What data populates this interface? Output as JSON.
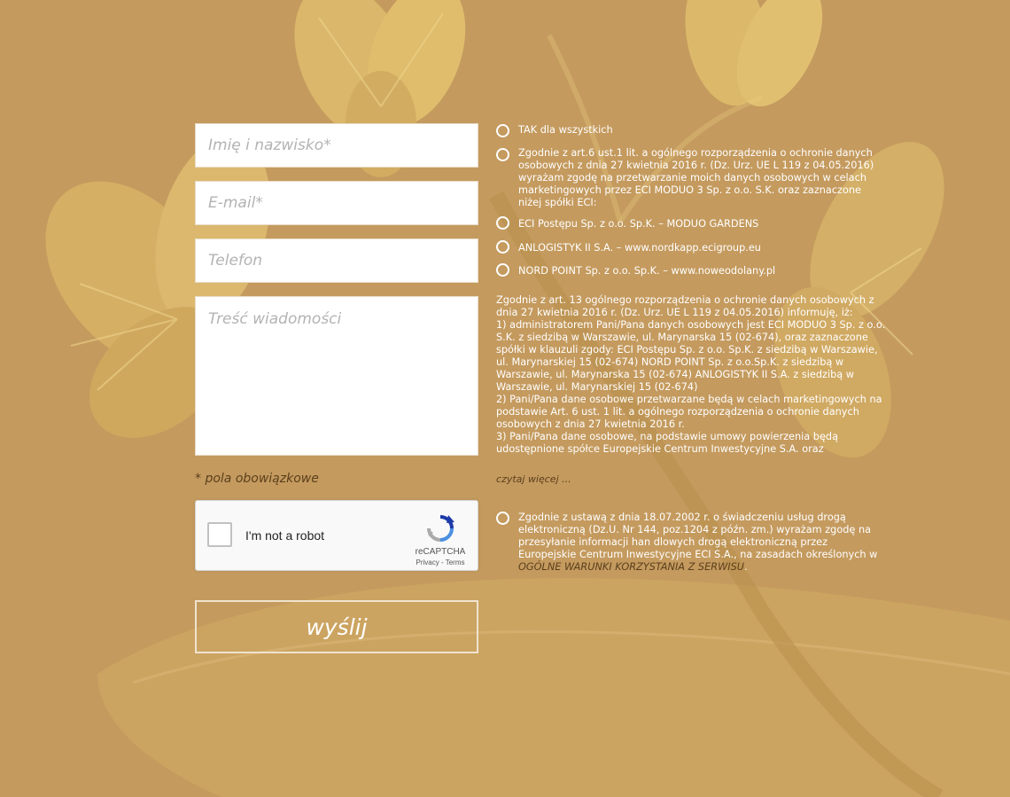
{
  "form": {
    "name_placeholder": "Imię i nazwisko*",
    "email_placeholder": "E-mail*",
    "phone_placeholder": "Telefon",
    "message_placeholder": "Treść wiadomości",
    "required_note": "* pola obowiązkowe",
    "submit_label": "wyślij"
  },
  "captcha": {
    "label": "I'm not a robot",
    "brand": "reCAPTCHA",
    "links": "Privacy - Terms"
  },
  "consents": {
    "all": "TAK dla wszystkich",
    "main": "Zgodnie z art.6 ust.1 lit. a ogólnego rozporządzenia o ochronie danych osobowych z dnia 27 kwietnia 2016 r. (Dz. Urz. UE L 119 z 04.05.2016) wyrażam zgodę na przetwarzanie moich danych osobowych w celach marketingowych przez ECI MODUO 3 Sp. z o.o. S.K. oraz zaznaczone niżej spółki ECI:",
    "company1": "ECI Postępu Sp. z o.o. Sp.K. – MODUO GARDENS",
    "company2": "ANLOGISTYK II S.A. – www.nordkapp.ecigroup.eu",
    "company3": "NORD POINT Sp. z o.o. Sp.K. – www.noweodolany.pl",
    "info": "Zgodnie z art. 13 ogólnego rozporządzenia o ochronie danych osobowych z dnia 27 kwietnia 2016 r. (Dz. Urz. UE L 119 z 04.05.2016) informuję, iż:\n1) administratorem Pani/Pana danych osobowych jest ECI MODUO 3 Sp. z o.o. S.K. z siedzibą w Warszawie, ul. Marynarska 15 (02-674), oraz zaznaczone spółki w klauzuli zgody: ECI Postępu Sp. z o.o. Sp.K. z siedzibą w Warszawie, ul. Marynarskiej 15 (02-674) NORD POINT Sp. z o.o.Sp.K. z siedzibą w Warszawie, ul. Marynarska 15 (02-674) ANLOGISTYK II S.A. z siedzibą w Warszawie, ul. Marynarskiej 15 (02-674)\n2) Pani/Pana dane osobowe przetwarzane będą w celach marketingowych na podstawie Art. 6 ust. 1 lit. a ogólnego rozporządzenia o ochronie danych osobowych z dnia 27 kwietnia 2016 r.\n3) Pani/Pana dane osobowe, na podstawie umowy powierzenia będą udostępnione spółce Europejskie Centrum Inwestycyjne S.A. oraz",
    "read_more": "czytaj więcej ...",
    "electronic": "Zgodnie z ustawą z dnia 18.07.2002 r. o świadczeniu usług drogą elektroniczną (Dz.U. Nr 144, poz.1204 z późn. zm.) wyrażam zgodę na przesyłanie informacji han  dlowych drogą elektroniczną przez Europejskie Centrum Inwestycyjne ECI S.A., na zasadach określonych w ",
    "terms_link": "OGÓLNE WARUNKI KORZYSTANIA Z SERWISU",
    "terms_suffix": "."
  },
  "colors": {
    "background": "#c49a5e",
    "accent_dark": "#5b3f1d"
  },
  "icons": [
    "flower-background-image",
    "recaptcha-logo-icon"
  ]
}
